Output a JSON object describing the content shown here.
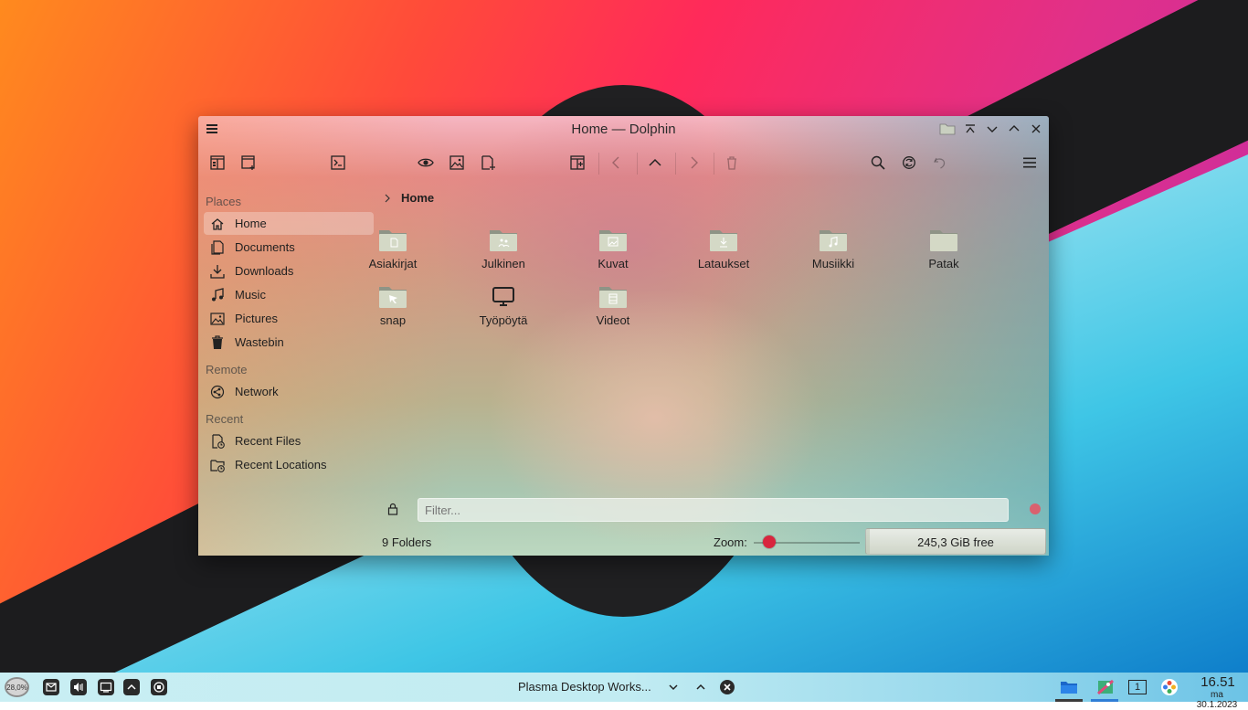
{
  "window": {
    "title": "Home — Dolphin"
  },
  "sidebar": {
    "places_header": "Places",
    "remote_header": "Remote",
    "recent_header": "Recent",
    "places": [
      {
        "label": "Home",
        "icon": "home-icon"
      },
      {
        "label": "Documents",
        "icon": "documents-icon"
      },
      {
        "label": "Downloads",
        "icon": "downloads-icon"
      },
      {
        "label": "Music",
        "icon": "music-icon"
      },
      {
        "label": "Pictures",
        "icon": "pictures-icon"
      },
      {
        "label": "Wastebin",
        "icon": "wastebin-icon"
      }
    ],
    "remote": [
      {
        "label": "Network",
        "icon": "network-icon"
      }
    ],
    "recent": [
      {
        "label": "Recent Files",
        "icon": "recent-files-icon"
      },
      {
        "label": "Recent Locations",
        "icon": "recent-locations-icon"
      }
    ]
  },
  "breadcrumb": {
    "current": "Home"
  },
  "folders": [
    {
      "name": "Asiakirjat",
      "icon": "documents-folder-icon"
    },
    {
      "name": "Julkinen",
      "icon": "public-folder-icon"
    },
    {
      "name": "Kuvat",
      "icon": "pictures-folder-icon"
    },
    {
      "name": "Lataukset",
      "icon": "downloads-folder-icon"
    },
    {
      "name": "Musiikki",
      "icon": "music-folder-icon"
    },
    {
      "name": "Patak",
      "icon": "folder-icon"
    },
    {
      "name": "snap",
      "icon": "snap-folder-icon"
    },
    {
      "name": "Työpöytä",
      "icon": "desktop-icon"
    },
    {
      "name": "Videot",
      "icon": "videos-folder-icon"
    }
  ],
  "filter": {
    "placeholder": "Filter..."
  },
  "status": {
    "summary": "9 Folders",
    "zoom_label": "Zoom:",
    "zoom_level": 0.15,
    "free_space": "245,3 GiB free",
    "used_fraction": 0.02
  },
  "taskbar": {
    "cpu_load": "28,0%",
    "task_title": "Plasma Desktop Works...",
    "desktop_number": "1",
    "time": "16.51",
    "date": "ma 30.1.2023"
  },
  "colors": {
    "accent": "#d8263e",
    "taskbar": "#c2ecf2"
  }
}
